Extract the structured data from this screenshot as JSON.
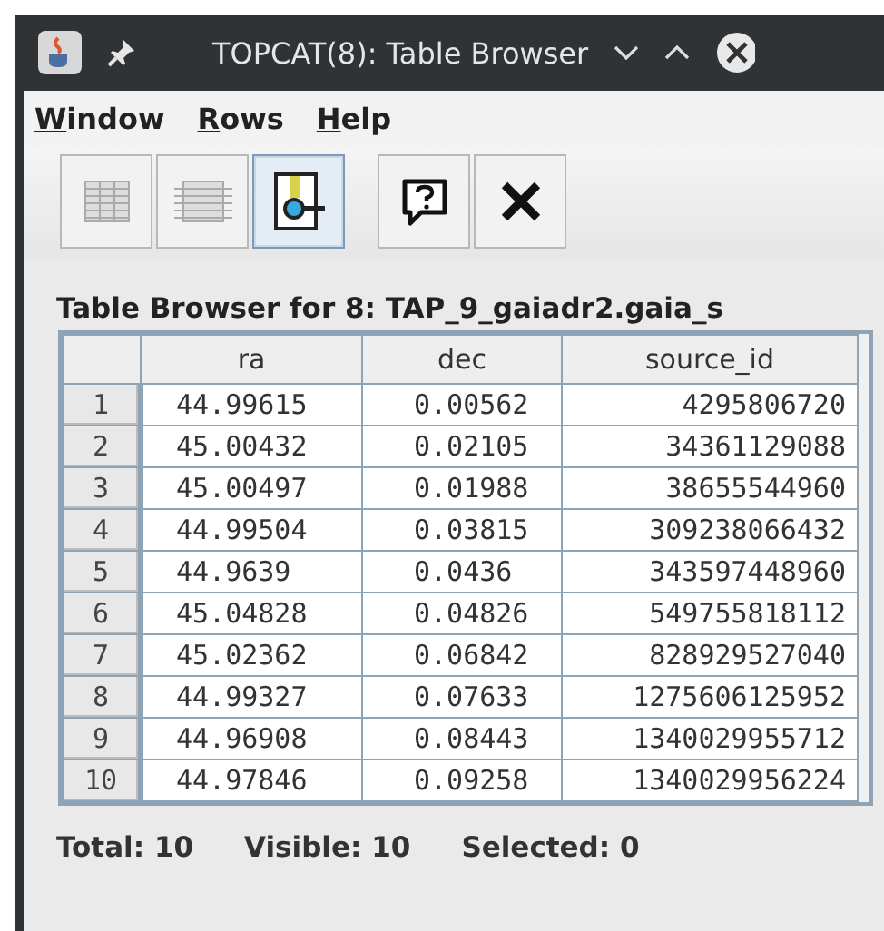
{
  "window": {
    "title": "TOPCAT(8): Table Browser"
  },
  "menu": [
    "Window",
    "Rows",
    "Help"
  ],
  "toolbar": [
    {
      "kind": "table",
      "disabled": true,
      "selected": false
    },
    {
      "kind": "table-lines",
      "disabled": true,
      "selected": false
    },
    {
      "kind": "search",
      "disabled": false,
      "selected": true
    },
    {
      "kind": "help",
      "disabled": false,
      "selected": false
    },
    {
      "kind": "close",
      "disabled": false,
      "selected": false
    }
  ],
  "panel_title": "Table Browser for 8: TAP_9_gaiadr2.gaia_s",
  "table": {
    "columns": [
      "",
      "ra",
      "dec",
      "source_id"
    ],
    "rows": [
      [
        "1",
        "44.99615",
        "0.00562",
        "4295806720"
      ],
      [
        "2",
        "45.00432",
        "0.02105",
        "34361129088"
      ],
      [
        "3",
        "45.00497",
        "0.01988",
        "38655544960"
      ],
      [
        "4",
        "44.99504",
        "0.03815",
        "309238066432"
      ],
      [
        "5",
        "44.9639",
        "0.0436",
        "343597448960"
      ],
      [
        "6",
        "45.04828",
        "0.04826",
        "549755818112"
      ],
      [
        "7",
        "45.02362",
        "0.06842",
        "828929527040"
      ],
      [
        "8",
        "44.99327",
        "0.07633",
        "1275606125952"
      ],
      [
        "9",
        "44.96908",
        "0.08443",
        "1340029955712"
      ],
      [
        "10",
        "44.97846",
        "0.09258",
        "1340029956224"
      ]
    ]
  },
  "status": [
    "Total: 10",
    "Visible: 10",
    "Selected: 0"
  ]
}
